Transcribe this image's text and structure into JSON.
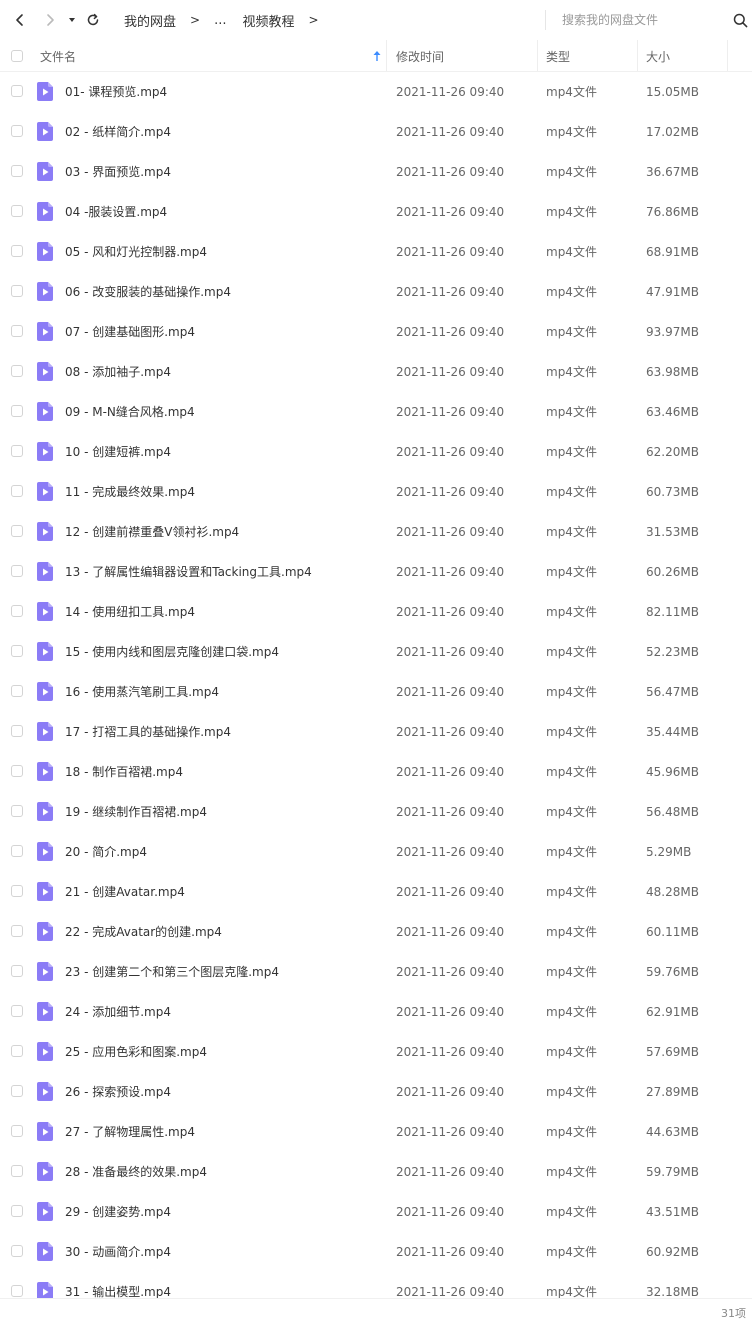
{
  "nav": {
    "back_icon": "chevron-left-icon",
    "forward_icon": "chevron-right-icon",
    "dropdown_icon": "caret-down-icon",
    "refresh_icon": "refresh-icon"
  },
  "breadcrumb": {
    "root": "我的网盘",
    "sep1": ">",
    "ellipsis": "...",
    "current": "视频教程",
    "sep2": ">"
  },
  "search": {
    "placeholder": "搜索我的网盘文件",
    "icon": "search-icon"
  },
  "columns": {
    "name": "文件名",
    "modified": "修改时间",
    "type": "类型",
    "size": "大小",
    "sort_icon": "arrow-up-icon"
  },
  "colors": {
    "file_icon": "#8b7cf6",
    "sort_arrow": "#3c8cff"
  },
  "files": [
    {
      "name": "01- 课程预览.mp4",
      "date": "2021-11-26 09:40",
      "type": "mp4文件",
      "size": "15.05MB"
    },
    {
      "name": "02 - 纸样简介.mp4",
      "date": "2021-11-26 09:40",
      "type": "mp4文件",
      "size": "17.02MB"
    },
    {
      "name": "03 - 界面预览.mp4",
      "date": "2021-11-26 09:40",
      "type": "mp4文件",
      "size": "36.67MB"
    },
    {
      "name": "04 -服装设置.mp4",
      "date": "2021-11-26 09:40",
      "type": "mp4文件",
      "size": "76.86MB"
    },
    {
      "name": "05 - 风和灯光控制器.mp4",
      "date": "2021-11-26 09:40",
      "type": "mp4文件",
      "size": "68.91MB"
    },
    {
      "name": "06 - 改变服装的基础操作.mp4",
      "date": "2021-11-26 09:40",
      "type": "mp4文件",
      "size": "47.91MB"
    },
    {
      "name": "07 - 创建基础图形.mp4",
      "date": "2021-11-26 09:40",
      "type": "mp4文件",
      "size": "93.97MB"
    },
    {
      "name": "08 - 添加袖子.mp4",
      "date": "2021-11-26 09:40",
      "type": "mp4文件",
      "size": "63.98MB"
    },
    {
      "name": "09 - M-N缝合风格.mp4",
      "date": "2021-11-26 09:40",
      "type": "mp4文件",
      "size": "63.46MB"
    },
    {
      "name": "10 - 创建短裤.mp4",
      "date": "2021-11-26 09:40",
      "type": "mp4文件",
      "size": "62.20MB"
    },
    {
      "name": "11 - 完成最终效果.mp4",
      "date": "2021-11-26 09:40",
      "type": "mp4文件",
      "size": "60.73MB"
    },
    {
      "name": "12 - 创建前襟重叠V领衬衫.mp4",
      "date": "2021-11-26 09:40",
      "type": "mp4文件",
      "size": "31.53MB"
    },
    {
      "name": "13 - 了解属性编辑器设置和Tacking工具.mp4",
      "date": "2021-11-26 09:40",
      "type": "mp4文件",
      "size": "60.26MB"
    },
    {
      "name": "14 - 使用纽扣工具.mp4",
      "date": "2021-11-26 09:40",
      "type": "mp4文件",
      "size": "82.11MB"
    },
    {
      "name": "15 - 使用内线和图层克隆创建口袋.mp4",
      "date": "2021-11-26 09:40",
      "type": "mp4文件",
      "size": "52.23MB"
    },
    {
      "name": "16 - 使用蒸汽笔刷工具.mp4",
      "date": "2021-11-26 09:40",
      "type": "mp4文件",
      "size": "56.47MB"
    },
    {
      "name": "17 - 打褶工具的基础操作.mp4",
      "date": "2021-11-26 09:40",
      "type": "mp4文件",
      "size": "35.44MB"
    },
    {
      "name": "18 - 制作百褶裙.mp4",
      "date": "2021-11-26 09:40",
      "type": "mp4文件",
      "size": "45.96MB"
    },
    {
      "name": "19 - 继续制作百褶裙.mp4",
      "date": "2021-11-26 09:40",
      "type": "mp4文件",
      "size": "56.48MB"
    },
    {
      "name": "20 - 简介.mp4",
      "date": "2021-11-26 09:40",
      "type": "mp4文件",
      "size": "5.29MB"
    },
    {
      "name": "21 - 创建Avatar.mp4",
      "date": "2021-11-26 09:40",
      "type": "mp4文件",
      "size": "48.28MB"
    },
    {
      "name": "22 - 完成Avatar的创建.mp4",
      "date": "2021-11-26 09:40",
      "type": "mp4文件",
      "size": "60.11MB"
    },
    {
      "name": "23 - 创建第二个和第三个图层克隆.mp4",
      "date": "2021-11-26 09:40",
      "type": "mp4文件",
      "size": "59.76MB"
    },
    {
      "name": "24 - 添加细节.mp4",
      "date": "2021-11-26 09:40",
      "type": "mp4文件",
      "size": "62.91MB"
    },
    {
      "name": "25 - 应用色彩和图案.mp4",
      "date": "2021-11-26 09:40",
      "type": "mp4文件",
      "size": "57.69MB"
    },
    {
      "name": "26 - 探索预设.mp4",
      "date": "2021-11-26 09:40",
      "type": "mp4文件",
      "size": "27.89MB"
    },
    {
      "name": "27 - 了解物理属性.mp4",
      "date": "2021-11-26 09:40",
      "type": "mp4文件",
      "size": "44.63MB"
    },
    {
      "name": "28 - 准备最终的效果.mp4",
      "date": "2021-11-26 09:40",
      "type": "mp4文件",
      "size": "59.79MB"
    },
    {
      "name": "29 - 创建姿势.mp4",
      "date": "2021-11-26 09:40",
      "type": "mp4文件",
      "size": "43.51MB"
    },
    {
      "name": "30 - 动画简介.mp4",
      "date": "2021-11-26 09:40",
      "type": "mp4文件",
      "size": "60.92MB"
    },
    {
      "name": "31 - 输出模型.mp4",
      "date": "2021-11-26 09:40",
      "type": "mp4文件",
      "size": "32.18MB"
    }
  ],
  "footer": {
    "count": "31项"
  }
}
